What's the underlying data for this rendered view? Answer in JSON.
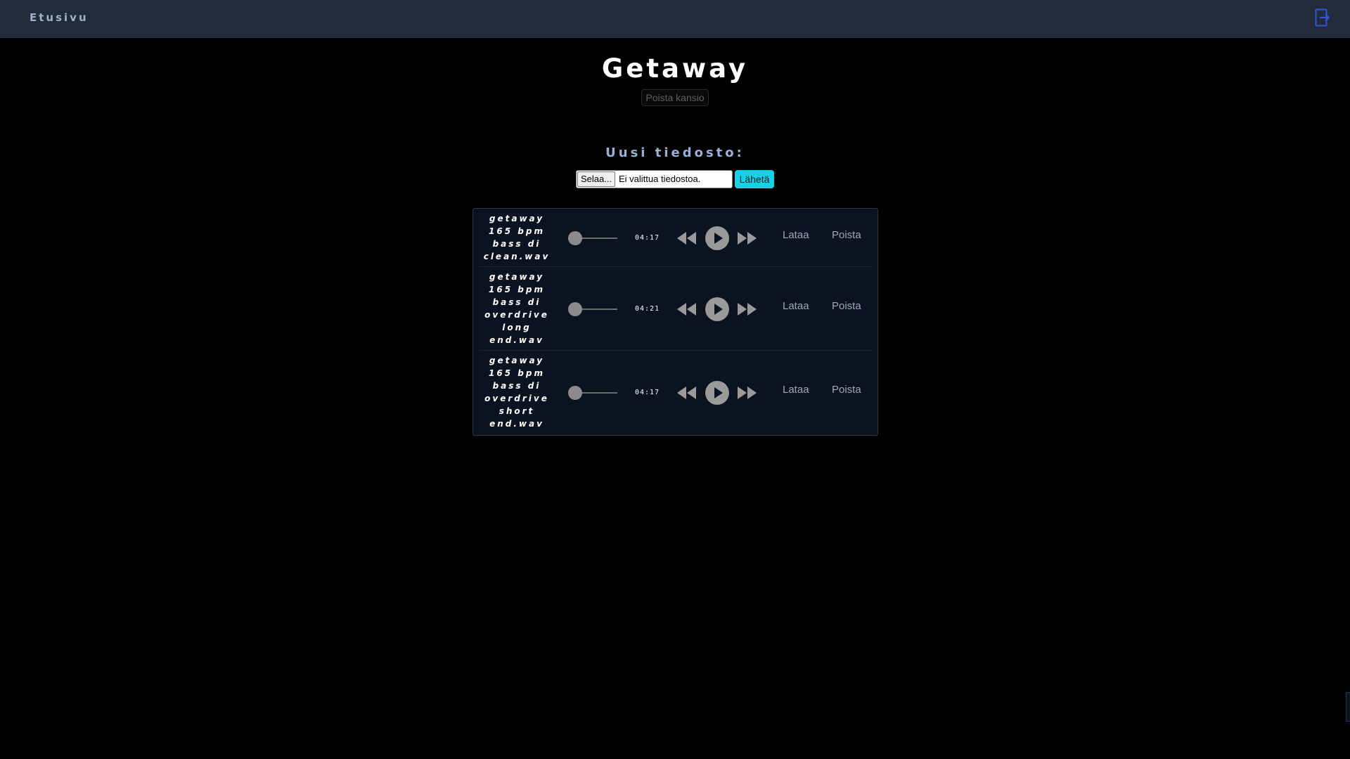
{
  "nav": {
    "home_label": "Etusivu",
    "logout_icon": "logout-icon"
  },
  "folder": {
    "title": "Getaway",
    "delete_label": "Poista kansio"
  },
  "upload": {
    "heading": "Uusi tiedosto:",
    "browse_label": "Selaa...",
    "no_file_label": "Ei valittua tiedostoa.",
    "send_label": "Lähetä"
  },
  "tracks": [
    {
      "name_lines": [
        "getaway",
        "165 bpm",
        "bass di",
        "clean.wav"
      ],
      "duration": "04:17",
      "progress": 0,
      "download_label": "Lataa",
      "delete_label": "Poista"
    },
    {
      "name_lines": [
        "getaway",
        "165 bpm",
        "bass di",
        "overdrive",
        "long",
        "end.wav"
      ],
      "duration": "04:21",
      "progress": 0,
      "download_label": "Lataa",
      "delete_label": "Poista"
    },
    {
      "name_lines": [
        "getaway",
        "165 bpm",
        "bass di",
        "overdrive",
        "short",
        "end.wav"
      ],
      "duration": "04:17",
      "progress": 0,
      "download_label": "Lataa",
      "delete_label": "Poista"
    }
  ],
  "icons": {
    "rewind": "rewind-icon",
    "play": "play-icon",
    "forward": "fast-forward-icon"
  },
  "colors": {
    "navbar": "#222b3a",
    "accent_button": "#17d2e6",
    "logout_icon": "#2f57d8",
    "heading": "#9bb0d8",
    "panel": "#0c1320"
  }
}
